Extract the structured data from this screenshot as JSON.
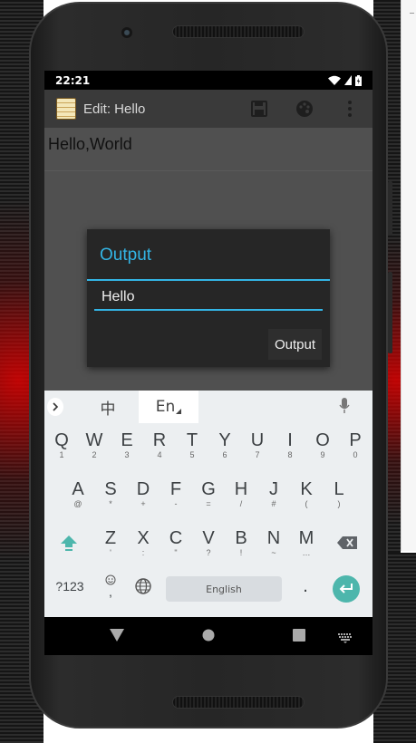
{
  "status_bar": {
    "time": "22:21"
  },
  "app_bar": {
    "title": "Edit: Hello"
  },
  "editor": {
    "text": "Hello,World"
  },
  "dialog": {
    "title": "Output",
    "input_value": "Hello",
    "button_label": "Output",
    "accent_color": "#33b5e5"
  },
  "keyboard": {
    "lang_zh": "中",
    "lang_en": "En",
    "row1": [
      {
        "key": "Q",
        "sub": "1"
      },
      {
        "key": "W",
        "sub": "2"
      },
      {
        "key": "E",
        "sub": "3"
      },
      {
        "key": "R",
        "sub": "4"
      },
      {
        "key": "T",
        "sub": "5"
      },
      {
        "key": "Y",
        "sub": "6"
      },
      {
        "key": "U",
        "sub": "7"
      },
      {
        "key": "I",
        "sub": "8"
      },
      {
        "key": "O",
        "sub": "9"
      },
      {
        "key": "P",
        "sub": "0"
      }
    ],
    "row2": [
      {
        "key": "A",
        "sub": "@"
      },
      {
        "key": "S",
        "sub": "*"
      },
      {
        "key": "D",
        "sub": "+"
      },
      {
        "key": "F",
        "sub": "-"
      },
      {
        "key": "G",
        "sub": "="
      },
      {
        "key": "H",
        "sub": "/"
      },
      {
        "key": "J",
        "sub": "#"
      },
      {
        "key": "K",
        "sub": "("
      },
      {
        "key": "L",
        "sub": ")"
      }
    ],
    "row3": [
      {
        "key": "Z",
        "sub": "'"
      },
      {
        "key": "X",
        "sub": ":"
      },
      {
        "key": "C",
        "sub": "\""
      },
      {
        "key": "V",
        "sub": "?"
      },
      {
        "key": "B",
        "sub": "!"
      },
      {
        "key": "N",
        "sub": "~"
      },
      {
        "key": "M",
        "sub": "…"
      }
    ],
    "symbols_label": "?123",
    "emoji_sub": ",",
    "space_label": "English",
    "period_label": ".",
    "enter_color": "#4db6ac"
  },
  "icons": {
    "app_icon": "notepad-icon",
    "save": "save-icon",
    "palette": "palette-icon",
    "overflow": "overflow-menu-icon"
  }
}
